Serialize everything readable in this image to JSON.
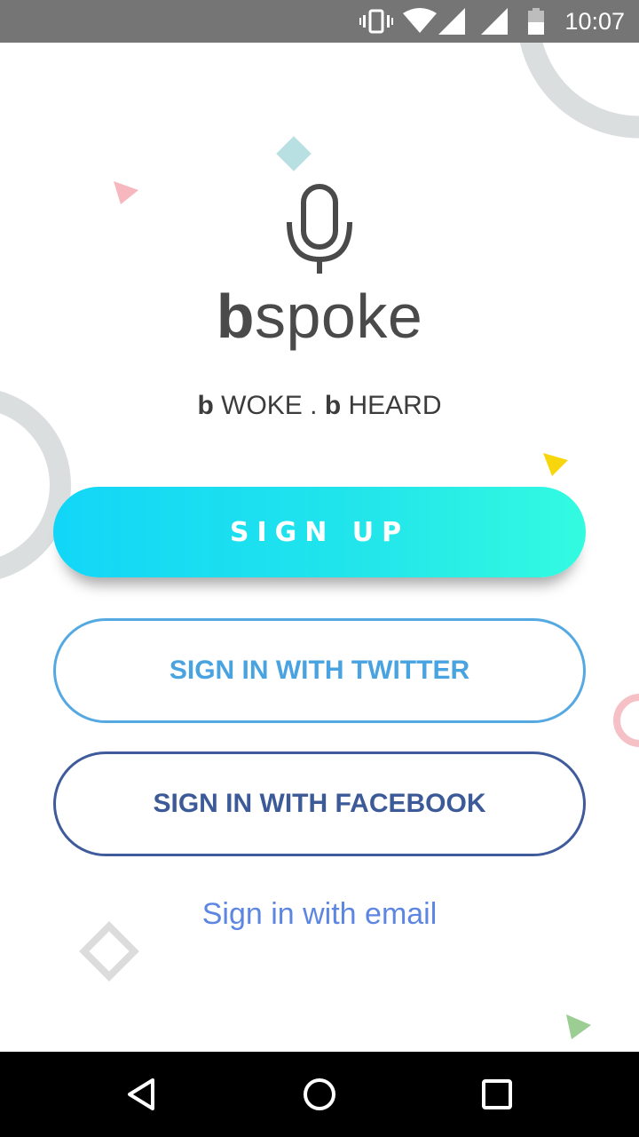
{
  "status_bar": {
    "time": "10:07",
    "icons": [
      "vibrate-icon",
      "wifi-icon",
      "signal-icon",
      "signal-icon",
      "battery-icon"
    ],
    "background": "#757575"
  },
  "brand": {
    "bold_part": "b",
    "rest": "spoke",
    "icon": "microphone-icon"
  },
  "tagline": {
    "part1_bold": "b",
    "part1": " WOKE . ",
    "part2_bold": "b",
    "part2": " HEARD"
  },
  "buttons": {
    "signup": "SIGN UP",
    "twitter": "SIGN IN WITH TWITTER",
    "facebook": "SIGN IN WITH FACEBOOK",
    "email": "Sign in with email"
  },
  "colors": {
    "signup_gradient_start": "#12d6f7",
    "signup_gradient_end": "#33fbe0",
    "twitter": "#48a3e0",
    "facebook": "#3d5a98",
    "email_link": "#5d86e2"
  },
  "nav_bar": {
    "icons": [
      "back-icon",
      "home-icon",
      "recents-icon"
    ]
  }
}
